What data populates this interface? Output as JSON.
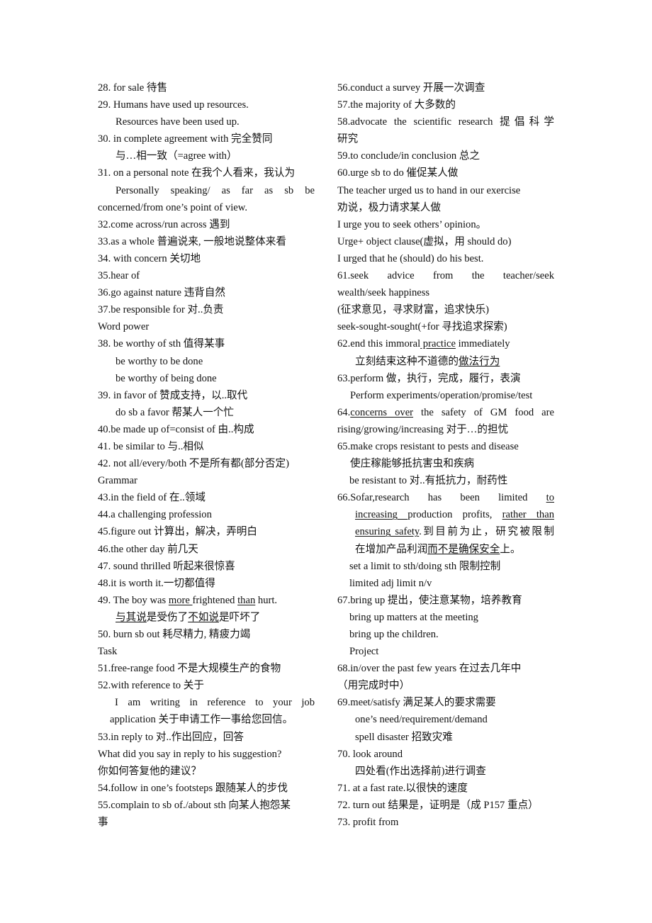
{
  "left": {
    "l1": "28. for sale 待售",
    "l2": "29. Humans have used up resources.",
    "l3": "Resources have been used up.",
    "l4": "30. in complete agreement with 完全赞同",
    "l5": "与…相一致（=agree with）",
    "l6": "31. on a personal note 在我个人看来，我认为",
    "l7": "Personally speaking/ as far as sb be",
    "l8": "concerned/from one’s point of view.",
    "l9": "32.come across/run across 遇到",
    "l10": "33.as a whole 普遍说来, 一般地说整体来看",
    "l11": "34. with concern 关切地",
    "l12": "35.hear of",
    "l13": "36.go against nature 违背自然",
    "l14": "37.be responsible for 对..负责",
    "l15": "Word power",
    "l16": "38. be worthy of sth 值得某事",
    "l17": "be worthy to be done",
    "l18": "be worthy of being done",
    "l19": "39. in favor of 赞成支持，以..取代",
    "l20": "do sb a favor 帮某人一个忙",
    "l21": "40.be made up of=consist of 由..构成",
    "l22": "41. be similar to 与..相似",
    "l23": "42. not all/every/both 不是所有都(部分否定)",
    "l24": "Grammar",
    "l25": "43.in the field of 在..领域",
    "l26": "44.a challenging profession",
    "l27": "45.figure out 计算出，解决，弄明白",
    "l28": "46.the other day 前几天",
    "l29": "47. sound thrilled 听起来很惊喜",
    "l30": "48.it is worth it.一切都值得",
    "l31": {
      "a": "49. The boy was ",
      "b": "more ",
      "c": "frightened ",
      "d": "than",
      "e": " hurt."
    },
    "l32": {
      "a": "与其说",
      "b": "是受伤了",
      "c": "不如说",
      "d": "是吓坏了"
    },
    "l33": "50. burn sb out 耗尽精力, 精疲力竭",
    "l34": "Task",
    "l35": "51.free-range food 不是大规模生产的食物",
    "l36": "52.with reference to 关于",
    "l37": "I am writing in reference to your job",
    "l38": "application 关于申请工作一事给您回信。",
    "l39": "53.in reply to 对..作出回应，回答",
    "l40": "What did you say in reply to his suggestion?",
    "l41": "你如何答复他的建议？",
    "l42": "54.follow in one’s footsteps 跟随某人的步伐",
    "l43": "55.complain to sb of./about sth 向某人抱怨某",
    "l44": "事"
  },
  "right": {
    "r1": "56.conduct a survey 开展一次调查",
    "r2": "57.the majority of  大多数的",
    "r3": "58.advocate the scientific research 提倡科学",
    "r4": "研究",
    "r5": "59.to conclude/in conclusion 总之",
    "r6": "60.urge sb to do 催促某人做",
    "r7": "The teacher urged us to hand in our exercise",
    "r8": "劝说，极力请求某人做",
    "r9": "I urge you to seek others’ opinion。",
    "r10": "Urge+ object clause(虚拟，用 should do)",
    "r11": "I urged that he (should) do his best.",
    "r12": "61.seek advice from the teacher/seek",
    "r13": "wealth/seek happiness",
    "r14": "(征求意见，寻求财富，追求快乐)",
    "r15": "seek-sought-sought(+for 寻找追求探索)",
    "r16": {
      "a": "62.end this immoral",
      "b": " practice",
      "c": " immediately"
    },
    "r17": {
      "a": "立刻结束这种不道德的",
      "b": "做法行为"
    },
    "r18": "63.perform 做，执行，完成，履行，表演",
    "r19": "Perform experiments/operation/promise/test",
    "r20": {
      "a": "64.",
      "b": "concerns over",
      "c": " the safety of GM food are"
    },
    "r21": "rising/growing/increasing 对于…的担忧",
    "r22": "65.make crops resistant to pests and disease",
    "r23": "使庄稼能够抵抗害虫和疾病",
    "r24": "be resistant to  对..有抵抗力，耐药性",
    "r25": {
      "a": "66.Sofar,research has been limited ",
      "b": "to"
    },
    "r26": {
      "a": "increasing ",
      "b": "production profits, ",
      "c": "rather than"
    },
    "r27": {
      "a": "ensuring safety",
      "b": ".到目前为止，研究被限制"
    },
    "r28": {
      "a": "在增加产品利润",
      "b": "而不是确保安全",
      "c": "上。"
    },
    "r29": "set a limit to sth/doing sth 限制控制",
    "r30": "limited adj limit n/v",
    "r31": "67.bring up 提出，使注意某物，培养教育",
    "r32": "bring up matters at the meeting",
    "r33": "bring up the children.",
    "r34": "Project",
    "r35": "68.in/over the past few years 在过去几年中",
    "r36": "（用完成时中）",
    "r37": "69.meet/satisfy  满足某人的要求需要",
    "r38": "one’s need/requirement/demand",
    "r39": "spell disaster 招致灾难",
    "r40": "70. look around",
    "r41": "四处看(作出选择前)进行调查",
    "r42": "71. at a fast rate.以很快的速度",
    "r43": "72. turn out 结果是，证明是（成 P157 重点）",
    "r44": "73. profit from"
  }
}
